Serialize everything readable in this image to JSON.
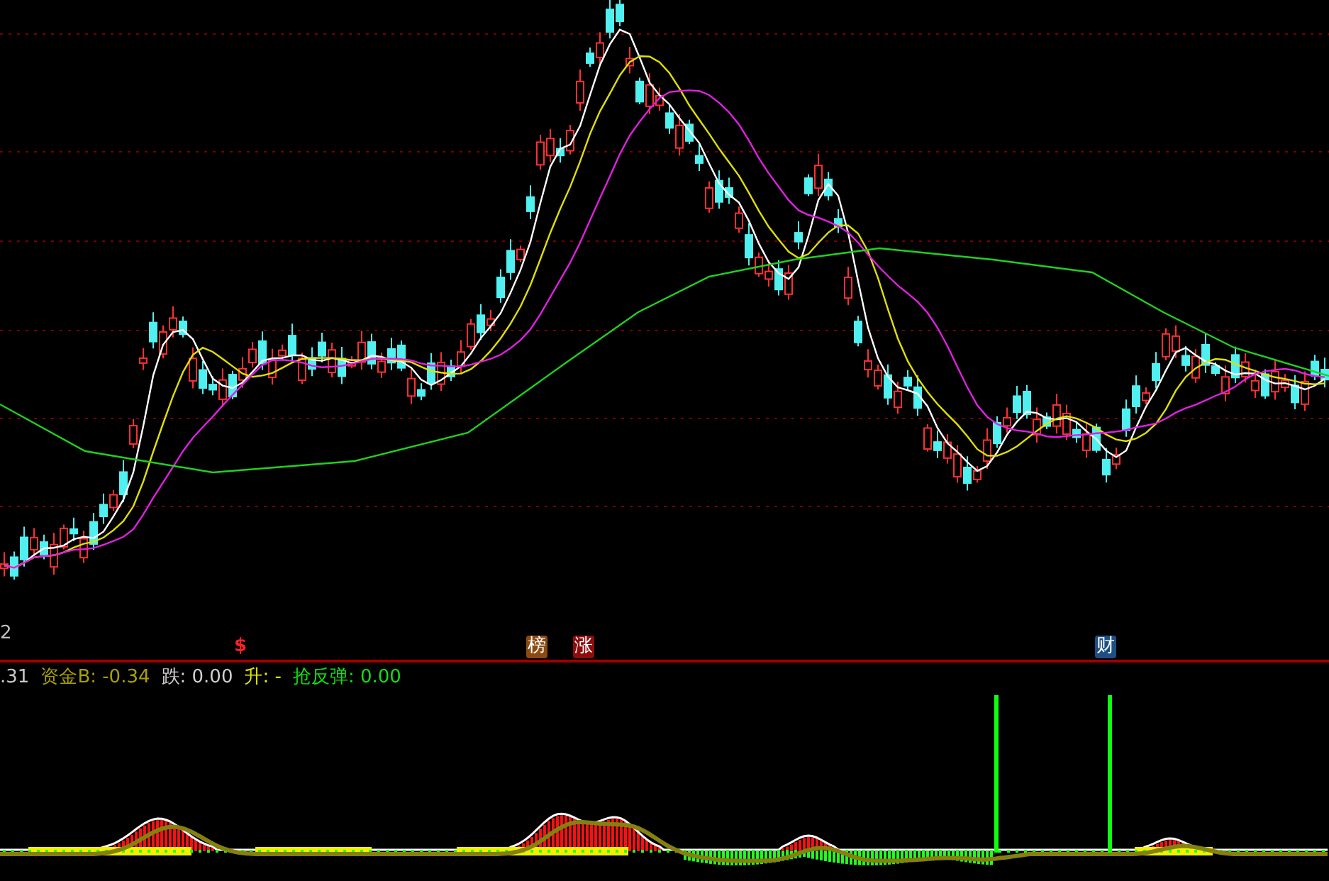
{
  "axis_label": "2",
  "markers": [
    {
      "kind": "symbol",
      "text": "$",
      "color": "#ff2020"
    },
    {
      "kind": "badge",
      "text": "榜",
      "color": "#8a4a12"
    },
    {
      "kind": "badge",
      "text": "涨",
      "color": "#8e0c0c"
    },
    {
      "kind": "badge",
      "text": "财",
      "color": "#1d4f86"
    }
  ],
  "legend": [
    {
      "text": ".31",
      "color": "#c8c8c8"
    },
    {
      "text": "资金B: -0.34",
      "color": "#a8a000"
    },
    {
      "text": "跌: 0.00",
      "color": "#d0d0d0"
    },
    {
      "text": "升: -",
      "color": "#e8e800"
    },
    {
      "text": "抢反弹: 0.00",
      "color": "#10e010"
    }
  ]
}
